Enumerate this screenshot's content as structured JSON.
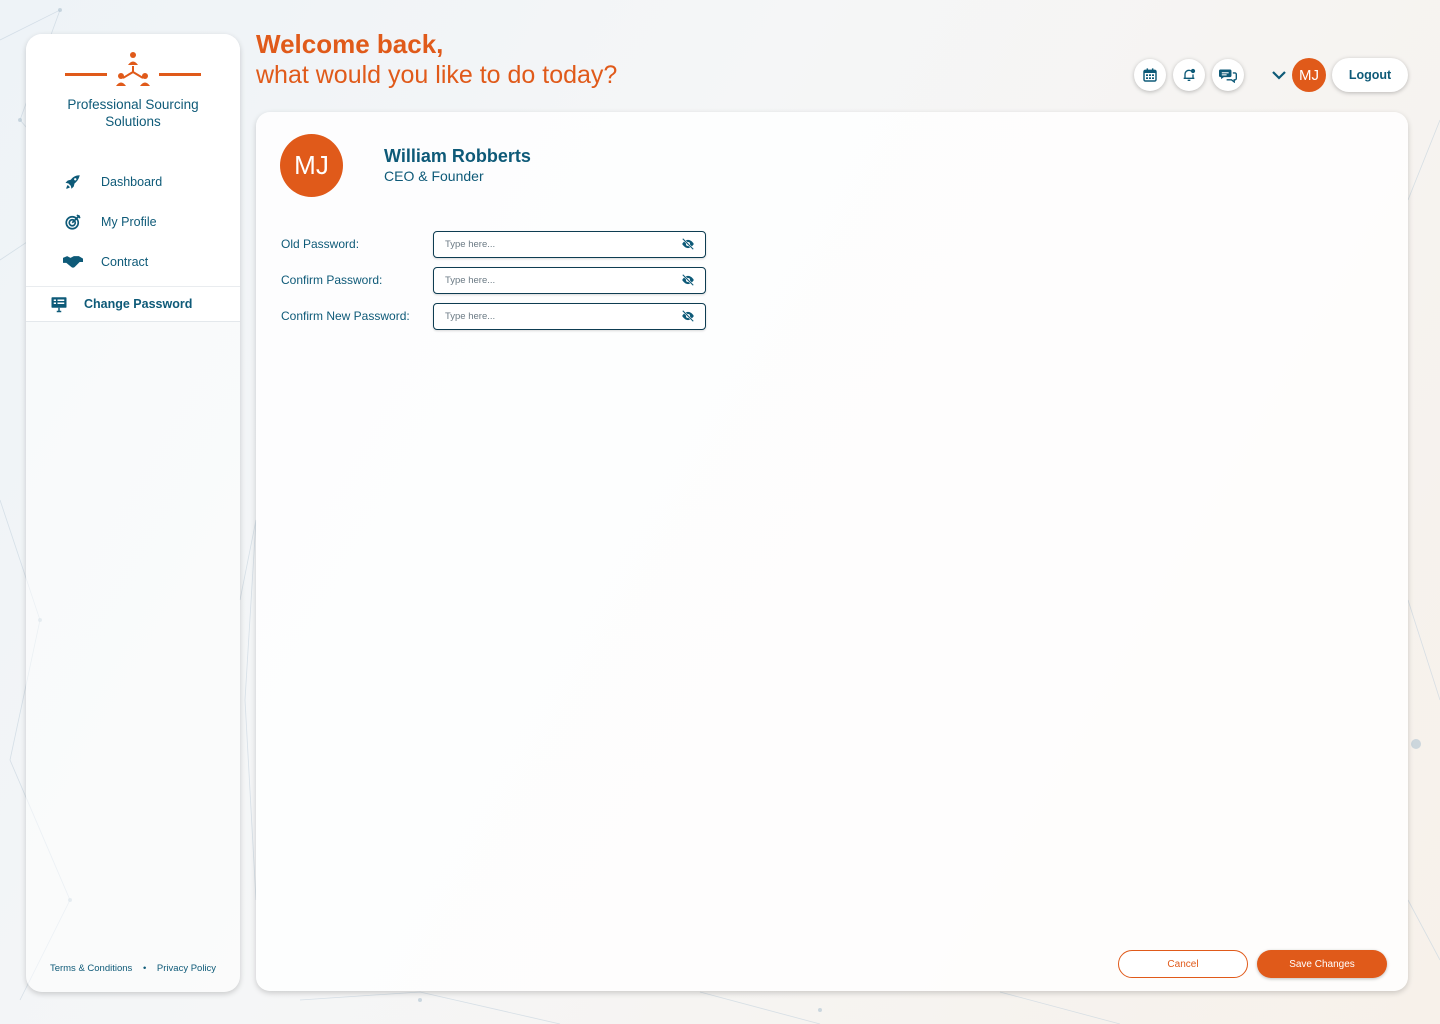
{
  "brand": {
    "name_line1": "Professional Sourcing",
    "name_line2": "Solutions",
    "accent_color": "#e05a1a",
    "primary_color": "#0e5a78"
  },
  "header": {
    "welcome_line1": "Welcome back,",
    "welcome_line2": "what would you like to do today?",
    "user_initials": "MJ",
    "logout_label": "Logout",
    "icons": [
      "calendar-icon",
      "notification-bell-icon",
      "chat-icon",
      "chevron-down-icon"
    ]
  },
  "sidebar": {
    "items": [
      {
        "label": "Dashboard",
        "icon": "rocket-icon"
      },
      {
        "label": "My Profile",
        "icon": "target-icon"
      },
      {
        "label": "Contract",
        "icon": "handshake-icon"
      },
      {
        "label": "Change Password",
        "icon": "presentation-icon",
        "active": true
      }
    ],
    "footer": {
      "terms": "Terms & Conditions",
      "separator": "•",
      "privacy": "Privacy Policy"
    }
  },
  "profile": {
    "initials": "MJ",
    "name": "William Robberts",
    "role": "CEO & Founder"
  },
  "form": {
    "fields": [
      {
        "label": "Old Password:",
        "placeholder": "Type here..."
      },
      {
        "label": "Confirm Password:",
        "placeholder": "Type here..."
      },
      {
        "label": "Confirm New Password:",
        "placeholder": "Type here..."
      }
    ],
    "cancel_label": "Cancel",
    "save_label": "Save Changes"
  }
}
